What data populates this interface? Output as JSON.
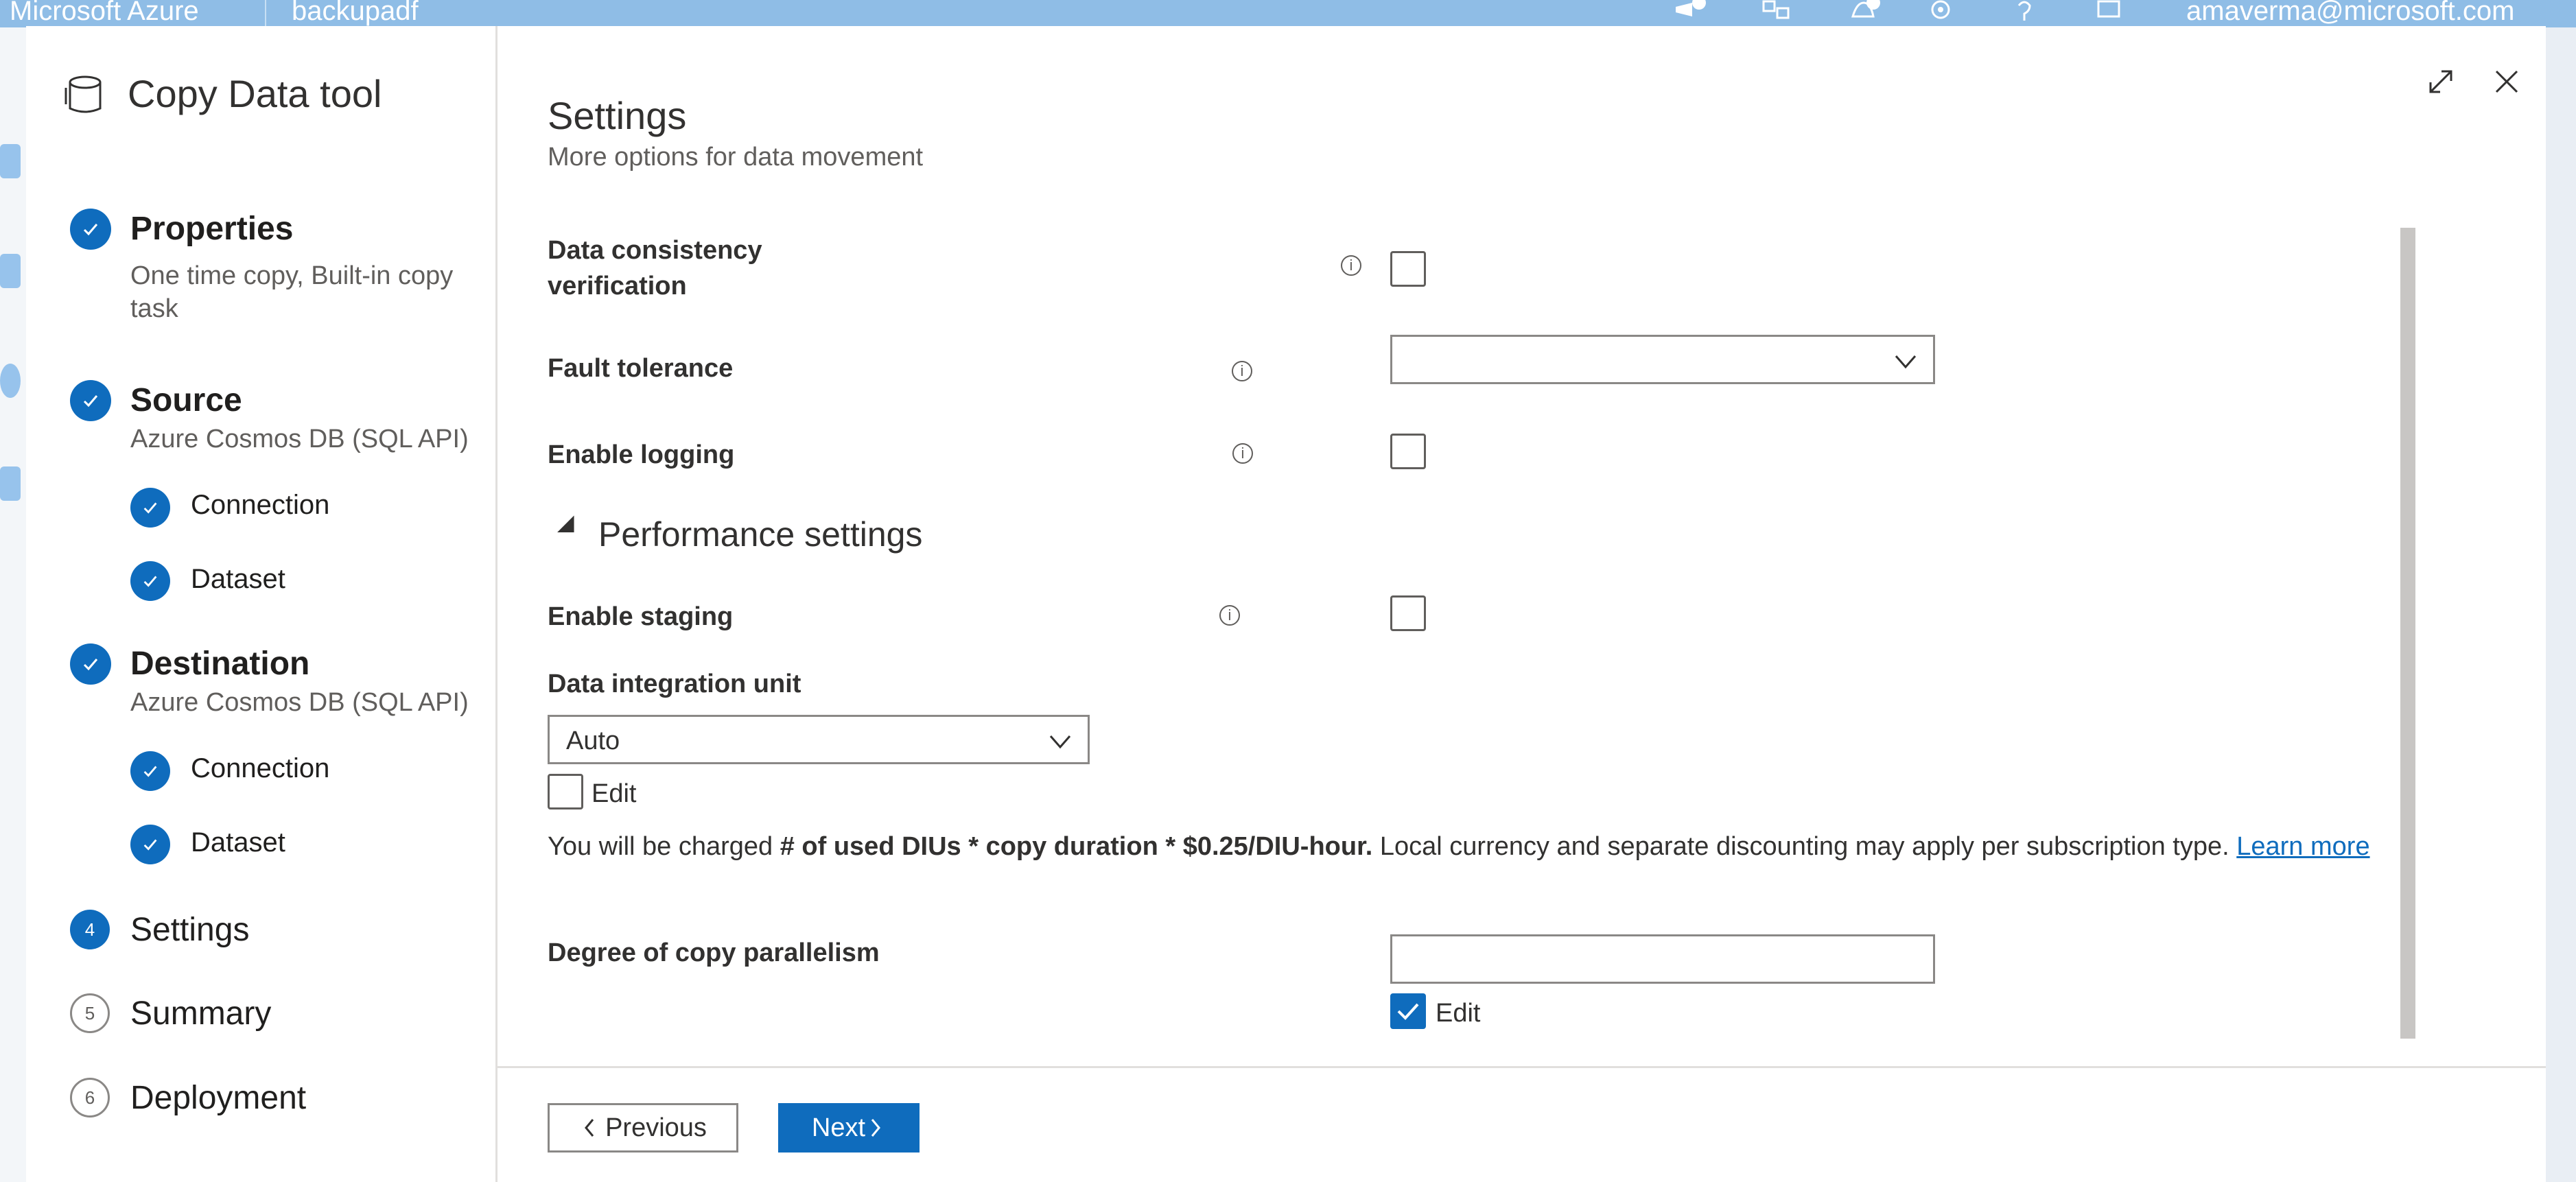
{
  "topbar": {
    "brand": "Microsoft Azure",
    "factory": "backupadf",
    "user": "amaverma@microsoft.com"
  },
  "sidebar": {
    "title": "Copy Data tool",
    "title_icon": "database-icon",
    "steps": [
      {
        "label": "Properties",
        "sub": "One time copy, Built-in copy task",
        "state": "done"
      },
      {
        "label": "Source",
        "sub": "Azure Cosmos DB (SQL API)",
        "state": "done",
        "substeps": [
          {
            "label": "Connection",
            "state": "done"
          },
          {
            "label": "Dataset",
            "state": "done"
          }
        ]
      },
      {
        "label": "Destination",
        "sub": "Azure Cosmos DB (SQL API)",
        "state": "done",
        "substeps": [
          {
            "label": "Connection",
            "state": "done"
          },
          {
            "label": "Dataset",
            "state": "done"
          }
        ]
      },
      {
        "label": "Settings",
        "number": "4",
        "state": "current"
      },
      {
        "label": "Summary",
        "number": "5",
        "state": "todo"
      },
      {
        "label": "Deployment",
        "number": "6",
        "state": "todo"
      }
    ]
  },
  "main": {
    "title": "Settings",
    "subtitle": "More options for data movement",
    "fields": {
      "data_consistency": {
        "label_line1": "Data consistency",
        "label_line2": "verification",
        "checked": false
      },
      "fault_tolerance": {
        "label": "Fault tolerance",
        "value": ""
      },
      "enable_logging": {
        "label": "Enable logging",
        "checked": false
      }
    },
    "performance": {
      "section_label": "Performance settings",
      "enable_staging": {
        "label": "Enable staging",
        "checked": false
      },
      "diu": {
        "label": "Data integration unit",
        "value": "Auto",
        "edit_label": "Edit",
        "edit_checked": false
      },
      "charge": {
        "prefix": "You will be charged ",
        "bold": "# of used DIUs * copy duration * $0.25/DIU-hour.",
        "suffix": " Local currency and separate discounting may apply per subscription type. ",
        "link": "Learn more"
      },
      "parallelism": {
        "label": "Degree of copy parallelism",
        "value": "",
        "edit_label": "Edit",
        "edit_checked": true
      }
    },
    "buttons": {
      "previous": "Previous",
      "next": "Next"
    }
  },
  "colors": {
    "accent": "#0f6cbd",
    "topbar": "#8fbde6"
  }
}
